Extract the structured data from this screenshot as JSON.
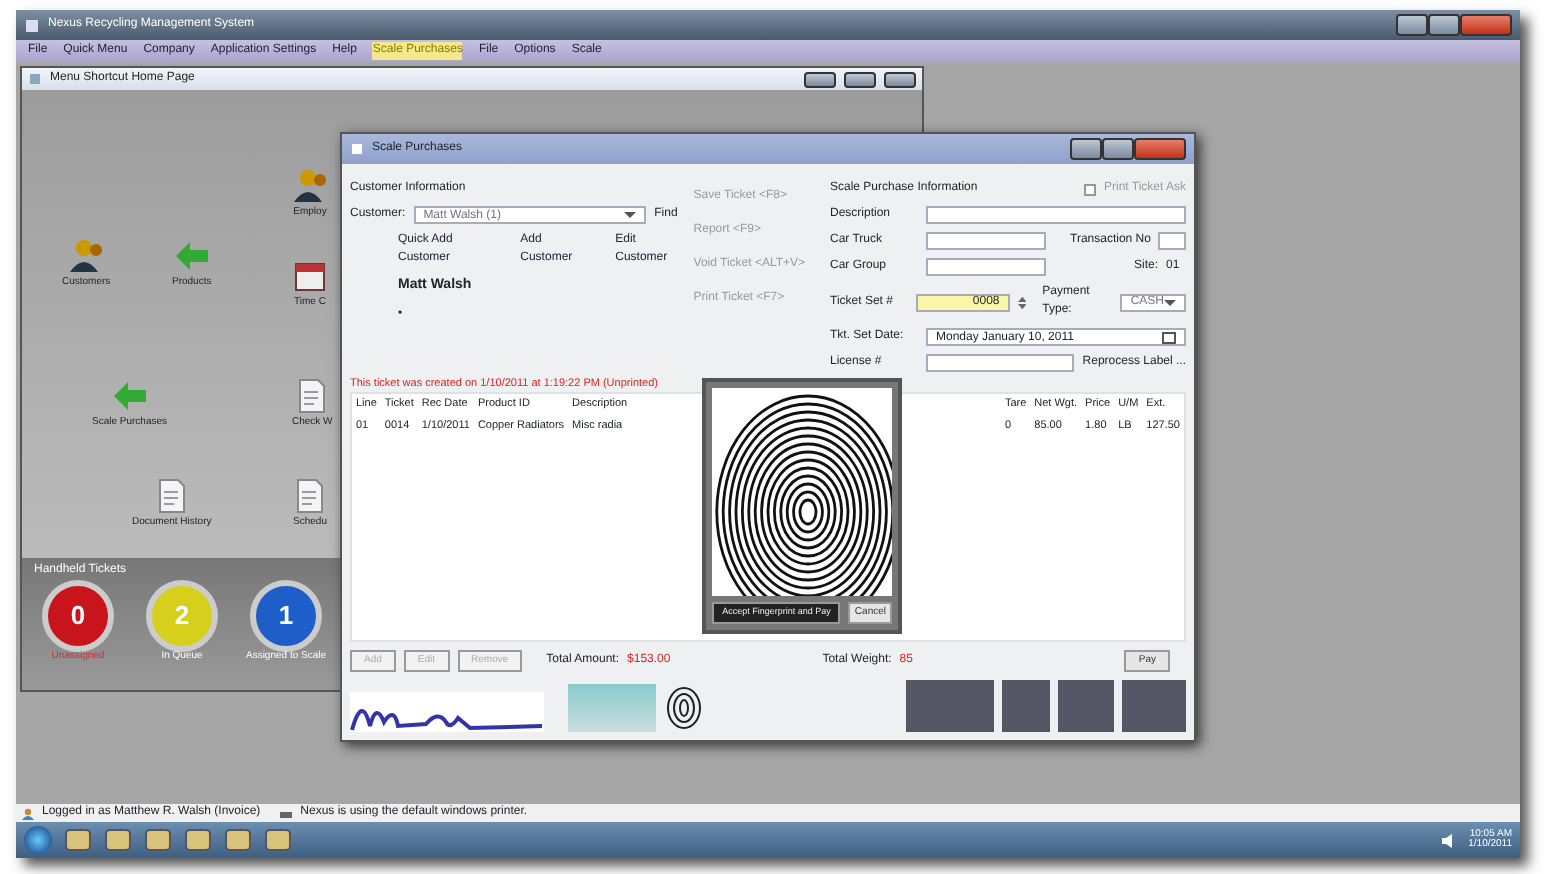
{
  "window": {
    "title": "Nexus Recycling Management System"
  },
  "menu": [
    {
      "label": "File",
      "highlighted": false
    },
    {
      "label": "Quick Menu",
      "highlighted": false
    },
    {
      "label": "Company",
      "highlighted": false
    },
    {
      "label": "Application Settings",
      "highlighted": false
    },
    {
      "label": "Help",
      "highlighted": false
    },
    {
      "label": "Scale Purchases",
      "highlighted": true
    },
    {
      "label": "File",
      "highlighted": false
    },
    {
      "label": "Options",
      "highlighted": false
    },
    {
      "label": "Scale",
      "highlighted": false
    }
  ],
  "home_page": {
    "title": "Menu Shortcut Home Page",
    "shortcuts": [
      {
        "label": "Customers",
        "kind": "people"
      },
      {
        "label": "Products",
        "kind": "arrow"
      },
      {
        "label": "Employ",
        "kind": "people"
      },
      {
        "label": "Time C",
        "kind": "calendar"
      },
      {
        "label": "Scale Purchases",
        "kind": "arrow"
      },
      {
        "label": "Check W",
        "kind": "document"
      },
      {
        "label": "Document History",
        "kind": "document"
      },
      {
        "label": "Schedu",
        "kind": "document"
      }
    ],
    "handheld": {
      "title": "Handheld Tickets",
      "dials": [
        {
          "value": "0",
          "label": "Unassigned",
          "color": "#c8141a"
        },
        {
          "value": "2",
          "label": "In Queue",
          "color": "#d6cf1c"
        },
        {
          "value": "1",
          "label": "Assigned to Scale",
          "color": "#1e5ec8"
        }
      ]
    }
  },
  "purchase": {
    "title": "Scale Purchases",
    "customer": {
      "heading": "Customer Information",
      "label": "Customer:",
      "value": "Matt Walsh (1)",
      "find": "Find",
      "links": [
        "Quick Add Customer",
        "Add Customer",
        "Edit Customer"
      ],
      "name": "Matt Walsh",
      "bullet": "•"
    },
    "actions": [
      {
        "label": "Save Ticket <F8>",
        "disabled": true
      },
      {
        "label": "Report <F9>",
        "disabled": true
      },
      {
        "label": "Void Ticket <ALT+V>",
        "disabled": true
      },
      {
        "label": "Print Ticket <F7>",
        "disabled": true
      }
    ],
    "info": {
      "heading": "Scale Purchase Information",
      "print_ask": {
        "label": "Print Ticket Ask",
        "checked": false
      },
      "fields": [
        {
          "label": "Description"
        },
        {
          "label": "Car Truck"
        },
        {
          "label": "Car Group"
        }
      ],
      "transaction_label": "Transaction No",
      "site_label": "Site:",
      "site": "01",
      "ticket_label": "Ticket Set #",
      "ticket": "0008",
      "payment_label": "Payment Type:",
      "payment": "CASH",
      "date_label": "Tkt. Set Date:",
      "date": "Monday   January  10, 2011",
      "license_label": "License #",
      "reprocess": "Reprocess Label ..."
    },
    "notice": "This ticket was created on 1/10/2011 at 1:19:22 PM (Unprinted)",
    "table": {
      "columns": [
        "Line",
        "Ticket",
        "Rec Date",
        "Product ID",
        "Description",
        "Tare",
        "Net Wgt.",
        "Price",
        "U/M",
        "Ext."
      ],
      "rows": [
        [
          "01",
          "0014",
          "1/10/2011",
          "Copper Radiators",
          "Misc radia",
          "0",
          "85.00",
          "1.80",
          "LB",
          "127.50"
        ]
      ]
    },
    "fingerprint": {
      "accept": "Accept Fingerprint and Pay",
      "cancel": "Cancel"
    },
    "buttons": [
      {
        "label": "Add",
        "disabled": true
      },
      {
        "label": "Edit",
        "disabled": true
      },
      {
        "label": "Remove",
        "disabled": true
      }
    ],
    "total_amount_label": "Total Amount:",
    "total_amount": "$153.00",
    "total_weight_label": "Total Weight:",
    "total_weight": "85",
    "pay": "Pay"
  },
  "status_bar": [
    "Logged in as Matthew R. Walsh (Invoice)",
    "Nexus is using the default windows printer."
  ],
  "taskbar": {
    "time": "10:05 AM",
    "date": "1/10/2011"
  }
}
